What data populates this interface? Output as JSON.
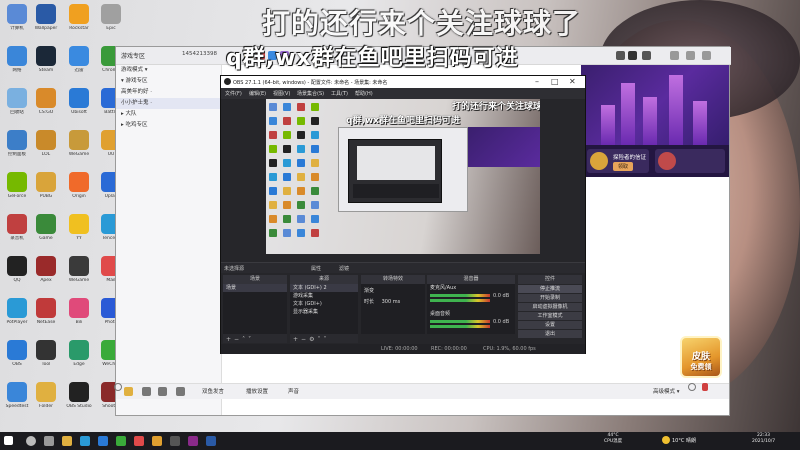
{
  "overlay": {
    "line1": "打的还行来个关注球球了",
    "line2": "q群,wx群在鱼吧里扫码可进"
  },
  "desktop": {
    "col1": [
      {
        "label": "计算机",
        "color": "#5a8ad6",
        "icon": "computer-icon"
      },
      {
        "label": "网络",
        "color": "#3a86d9",
        "icon": "steam-icon"
      },
      {
        "label": "回收站",
        "color": "#7ab0e0",
        "icon": "recycle-bin-icon"
      },
      {
        "label": "控制面板",
        "color": "#3c7ec8",
        "icon": "control-panel-icon"
      },
      {
        "label": "GeForce",
        "color": "#76b900",
        "icon": "geforce-icon"
      },
      {
        "label": "录音机",
        "color": "#c04040",
        "icon": "recorder-icon"
      },
      {
        "label": "QQ",
        "color": "#222222",
        "icon": "qq-icon"
      },
      {
        "label": "PotPlayer",
        "color": "#2a9ad6",
        "icon": "player-icon"
      },
      {
        "label": "OBS",
        "color": "#2a7ad6",
        "icon": "obs-icon"
      },
      {
        "label": "Speedtest",
        "color": "#3a86d9",
        "icon": "speedtest-icon"
      }
    ],
    "col2": [
      {
        "label": "Wallpaper",
        "color": "#2a5aa6",
        "icon": "wallpaper-icon"
      },
      {
        "label": "Steam",
        "color": "#1b2838",
        "icon": "steam-icon"
      },
      {
        "label": "CS:GO",
        "color": "#d98a2a",
        "icon": "csgo-icon"
      },
      {
        "label": "LOL",
        "color": "#c98a2a",
        "icon": "lol-icon"
      },
      {
        "label": "PUBG",
        "color": "#d9a43a",
        "icon": "pubg-icon"
      },
      {
        "label": "Game",
        "color": "#3a8a3a",
        "icon": "game-icon"
      },
      {
        "label": "Apex",
        "color": "#9a2a2a",
        "icon": "apex-icon"
      },
      {
        "label": "NetEase",
        "color": "#c03a3a",
        "icon": "netease-icon"
      },
      {
        "label": "Tool",
        "color": "#333333",
        "icon": "tool-icon"
      },
      {
        "label": "Folder",
        "color": "#e0b040",
        "icon": "folder-icon"
      }
    ],
    "col3": [
      {
        "label": "Rockstar",
        "color": "#f0a020",
        "icon": "rockstar-icon"
      },
      {
        "label": "迅雷",
        "color": "#3a8ae0",
        "icon": "thunder-icon"
      },
      {
        "label": "Ubisoft",
        "color": "#2a7ad6",
        "icon": "ubisoft-icon"
      },
      {
        "label": "WeGame",
        "color": "#c89a3a",
        "icon": "wegame-icon"
      },
      {
        "label": "Origin",
        "color": "#f06a2a",
        "icon": "origin-icon"
      },
      {
        "label": "YY",
        "color": "#f0c020",
        "icon": "yy-icon"
      },
      {
        "label": "WeGame",
        "color": "#3a3a3a",
        "icon": "wegame2-icon"
      },
      {
        "label": "Bili",
        "color": "#e04a7a",
        "icon": "bili-icon"
      },
      {
        "label": "Edge",
        "color": "#2a9a6a",
        "icon": "edge-icon"
      },
      {
        "label": "OBS Studio",
        "color": "#222222",
        "icon": "obs-studio-icon"
      }
    ],
    "col4": [
      {
        "label": "Epic",
        "color": "#a0a0a0",
        "icon": "epic-icon"
      },
      {
        "label": "Chrome",
        "color": "#3a9a3a",
        "icon": "chrome-icon"
      },
      {
        "label": "Battle",
        "color": "#2a6ad6",
        "icon": "battle-icon"
      },
      {
        "label": "UU",
        "color": "#e0a030",
        "icon": "uu-icon"
      },
      {
        "label": "Uplay",
        "color": "#2a6ad6",
        "icon": "uplay-icon"
      },
      {
        "label": "Tencent",
        "color": "#2a9ad6",
        "icon": "tencent-icon"
      },
      {
        "label": "Mail",
        "color": "#e04a4a",
        "icon": "mail-icon"
      },
      {
        "label": "Photo",
        "color": "#2a5ad6",
        "icon": "photo-icon"
      },
      {
        "label": "WeChat",
        "color": "#3aaa3a",
        "icon": "wechat-icon"
      },
      {
        "label": "Shooter",
        "color": "#8a2a2a",
        "icon": "shooter-icon"
      }
    ]
  },
  "chat_window": {
    "title": "游戏专区",
    "number": "1454213398",
    "sidebar": [
      "游戏模式 ▾",
      "▾ 游戏专区",
      "  高美年的好 ·",
      "  小小护士鬼 ·",
      "▸ 大队",
      "▸ 吃鸡专区"
    ],
    "banner_card1": {
      "title": "探险者的信证",
      "button": "领取"
    },
    "bottom_items": [
      "双鱼发言",
      "播放设置",
      "声音"
    ],
    "bottom_right": "高级模式 ▾"
  },
  "obs": {
    "title": "OBS 27.1.1 (64-bit, windows) - 配置文件: 未命名 - 场景集: 未命名",
    "menu": [
      "文件(F)",
      "编辑(E)",
      "视图(V)",
      "场景集合(S)",
      "工具(T)",
      "帮助(H)"
    ],
    "midbar_left": "未选择源",
    "midbar_items": [
      "属性",
      "滤镜"
    ],
    "panels": [
      "场景",
      "来源",
      "混音器",
      "转场特效",
      "控件"
    ],
    "scene_item": "场景",
    "sources": [
      "文本 (GDI+) 2",
      "游戏采集",
      "文本 (GDI+)",
      "显示器采集"
    ],
    "transition": {
      "type": "渐变",
      "duration_label": "时长",
      "duration": "300 ms"
    },
    "mixer": [
      {
        "name": "麦克风/Aux",
        "level": "0.0 dB"
      },
      {
        "name": "桌面音频",
        "level": "0.0 dB"
      }
    ],
    "controls": [
      "停止推流",
      "开始录制",
      "启动虚拟摄像机",
      "工作室模式",
      "设置",
      "退出"
    ],
    "status": [
      "LIVE: 00:00:00",
      "REC: 00:00:00",
      "CPU: 1.9%, 60.00 fps"
    ]
  },
  "game_badge": {
    "line1": "皮肤",
    "line2": "免费领"
  },
  "taskbar": {
    "temp": "44°C",
    "temp_label": "CPU温度",
    "weather": "10°C 晴朗",
    "time": "22:33",
    "date": "2021/10/7"
  }
}
